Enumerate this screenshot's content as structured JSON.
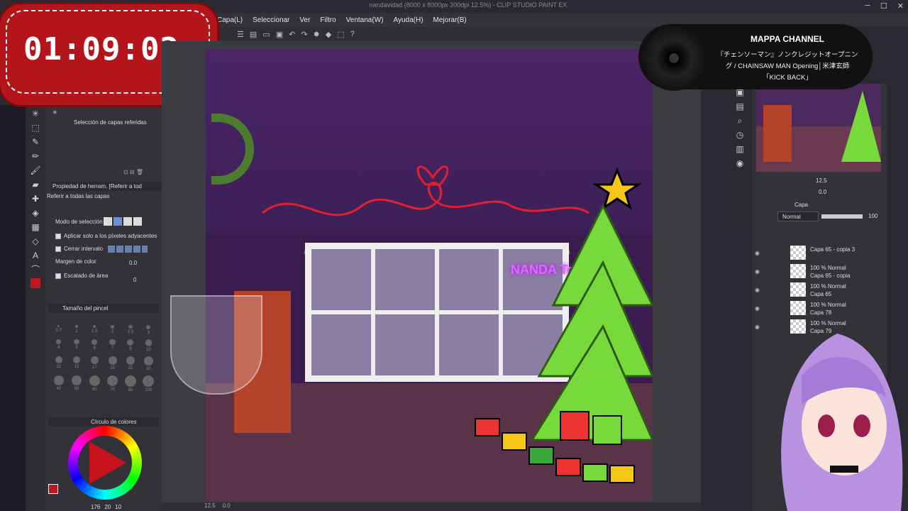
{
  "window": {
    "title": "nandavidad (8000 x 8000px 300dpi 12.5%) - CLIP STUDIO PAINT EX"
  },
  "menu": [
    "Capa(L)",
    "Seleccionar",
    "Ver",
    "Filtro",
    "Ventana(W)",
    "Ayuda(H)",
    "Mejorar(B)"
  ],
  "timer": {
    "value": "01:09:02",
    "color": "#b3151b"
  },
  "tool_panel": {
    "subtool": "Selección de capas referidas",
    "prop_title": "Propiedad de herram. [Referir a tod",
    "refer_all": "Referir a todas las capas",
    "selection_mode": "Modo de selección",
    "adjacent": "Aplicar solo a los píxeles adyacentes",
    "close_gap": "Cerrar intervalo",
    "color_margin": "Margen de color",
    "color_margin_val": "0.0",
    "area_scale": "Escalado de área",
    "area_scale_val": "0"
  },
  "brush_size": {
    "title": "Tamaño del pincel",
    "sizes": [
      "0.7",
      "1",
      "1.5",
      "2",
      "2.5",
      "3",
      "4",
      "5",
      "6",
      "7",
      "8",
      "10",
      "12",
      "15",
      "17",
      "20",
      "25",
      "30",
      "40",
      "50",
      "60",
      "70",
      "80",
      "100"
    ]
  },
  "color_wheel": {
    "title": "Círculo de colores",
    "values": [
      "176",
      "20",
      "10"
    ]
  },
  "canvas": {
    "neon_text": "NANDA Toon",
    "zoom": "12.5",
    "angle": "0.0"
  },
  "layers": {
    "blend": "Normal",
    "opacity": "100",
    "tab": "Capa",
    "items": [
      {
        "mode": "Capa 65 - copia 3",
        "name": ""
      },
      {
        "mode": "100 % Normal",
        "name": "Capa 65 - copia"
      },
      {
        "mode": "100 % Normal",
        "name": "Capa 65"
      },
      {
        "mode": "100 % Normal",
        "name": "Capa 78"
      },
      {
        "mode": "100 % Normal",
        "name": "Capa 79"
      }
    ]
  },
  "navigator": {
    "zoom": "12.5",
    "angle": "0.0"
  },
  "music": {
    "channel": "MAPPA CHANNEL",
    "track": "『チェンソーマン』ノンクレジットオープニング / CHAINSAW MAN Opening│米津玄師「KICK BACK」"
  }
}
